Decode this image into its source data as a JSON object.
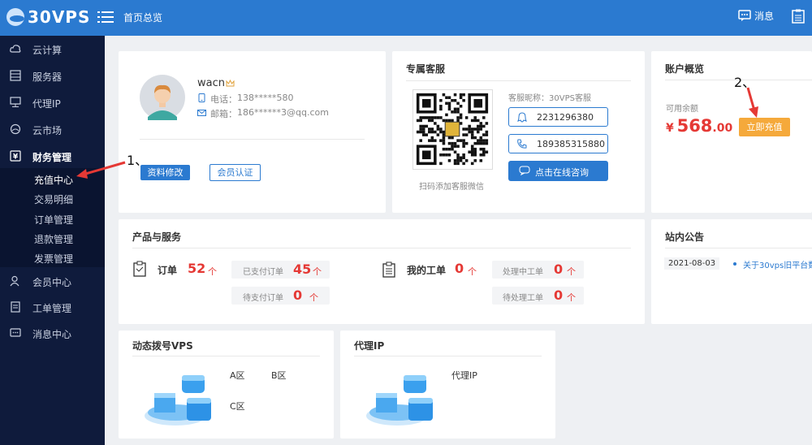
{
  "brand": {
    "name": "30VPS"
  },
  "header": {
    "home": "首页总览",
    "messages": "消息"
  },
  "sidebar": {
    "items": [
      {
        "label": "云计算"
      },
      {
        "label": "服务器"
      },
      {
        "label": "代理IP"
      },
      {
        "label": "云市场"
      },
      {
        "label": "财务管理"
      },
      {
        "label": "会员中心"
      },
      {
        "label": "工单管理"
      },
      {
        "label": "消息中心"
      }
    ],
    "finance_sub": [
      {
        "label": "充值中心"
      },
      {
        "label": "交易明细"
      },
      {
        "label": "订单管理"
      },
      {
        "label": "退款管理"
      },
      {
        "label": "发票管理"
      }
    ]
  },
  "profile": {
    "username": "wacn",
    "phone_label": "电话：",
    "phone": "138*****580",
    "email_label": "邮箱：",
    "email": "186******3@qq.com",
    "edit_button": "资料修改",
    "verify_button": "会员认证"
  },
  "support": {
    "title": "专属客服",
    "nickname": "客服昵称：30VPS客服",
    "qq": "2231296380",
    "phone": "189385315880",
    "consult_button": "点击在线咨询",
    "qr_caption": "扫码添加客服微信"
  },
  "account": {
    "title": "账户概览",
    "balance_label": "可用余额",
    "currency": "¥",
    "balance_int": "568",
    "balance_dec": ".00",
    "recharge_button": "立即充值"
  },
  "products": {
    "title": "产品与服务",
    "orders_label": "订单",
    "orders_count": "52",
    "unit": "个",
    "paid_label": "已支付订单",
    "paid_count": "45",
    "pending_label": "待支付订单",
    "pending_count": "0",
    "tickets_label": "我的工单",
    "tickets_count": "0",
    "processing_label": "处理中工单",
    "processing_count": "0",
    "todo_label": "待处理工单",
    "todo_count": "0"
  },
  "notice": {
    "title": "站内公告",
    "date": "2021-08-03",
    "text": "关于30vps旧平台数"
  },
  "dial_vps": {
    "title": "动态拨号VPS",
    "zone_a": "A区",
    "zone_b": "B区",
    "zone_c": "C区"
  },
  "proxy": {
    "title": "代理IP",
    "item": "代理IP"
  },
  "annotations": {
    "step1": "1、",
    "step2": "2、"
  },
  "colors": {
    "primary": "#2b7ad0",
    "sidebar": "#0f1b3c",
    "accent_orange": "#f5a93b",
    "price_red": "#e53935"
  }
}
